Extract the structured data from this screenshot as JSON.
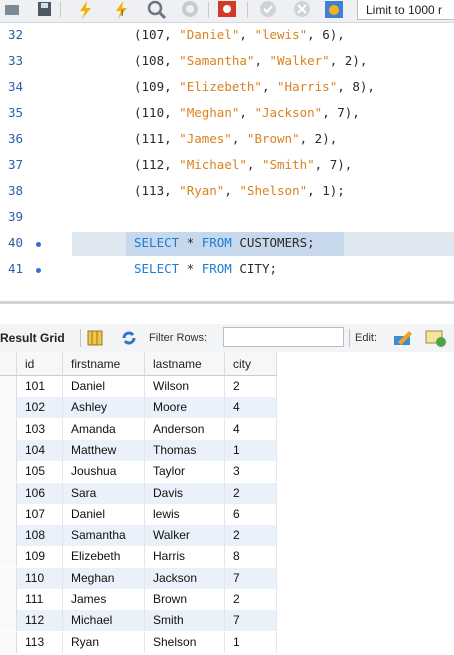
{
  "toolbar": {
    "limit_label": "Limit to 1000 r",
    "icons": [
      "folder-icon",
      "save-icon",
      "execute-icon",
      "execute-current-icon",
      "find-icon",
      "stop-icon",
      "toggle-output-icon",
      "commit-icon",
      "rollback-icon",
      "autocommit-icon"
    ]
  },
  "editor": {
    "lines": [
      {
        "n": "32",
        "parts": [
          {
            "t": "(",
            "c": "id"
          },
          {
            "t": "107",
            "c": "num"
          },
          {
            "t": ", ",
            "c": "id"
          },
          {
            "t": "\"Daniel\"",
            "c": "str"
          },
          {
            "t": ", ",
            "c": "id"
          },
          {
            "t": "\"lewis\"",
            "c": "str"
          },
          {
            "t": ", ",
            "c": "id"
          },
          {
            "t": "6",
            "c": "num"
          },
          {
            "t": "),",
            "c": "id"
          }
        ]
      },
      {
        "n": "33",
        "parts": [
          {
            "t": "(",
            "c": "id"
          },
          {
            "t": "108",
            "c": "num"
          },
          {
            "t": ", ",
            "c": "id"
          },
          {
            "t": "\"Samantha\"",
            "c": "str"
          },
          {
            "t": ", ",
            "c": "id"
          },
          {
            "t": "\"Walker\"",
            "c": "str"
          },
          {
            "t": ", ",
            "c": "id"
          },
          {
            "t": "2",
            "c": "num"
          },
          {
            "t": "),",
            "c": "id"
          }
        ]
      },
      {
        "n": "34",
        "parts": [
          {
            "t": "(",
            "c": "id"
          },
          {
            "t": "109",
            "c": "num"
          },
          {
            "t": ", ",
            "c": "id"
          },
          {
            "t": "\"Elizebeth\"",
            "c": "str"
          },
          {
            "t": ", ",
            "c": "id"
          },
          {
            "t": "\"Harris\"",
            "c": "str"
          },
          {
            "t": ", ",
            "c": "id"
          },
          {
            "t": "8",
            "c": "num"
          },
          {
            "t": "),",
            "c": "id"
          }
        ]
      },
      {
        "n": "35",
        "parts": [
          {
            "t": "(",
            "c": "id"
          },
          {
            "t": "110",
            "c": "num"
          },
          {
            "t": ", ",
            "c": "id"
          },
          {
            "t": "\"Meghan\"",
            "c": "str"
          },
          {
            "t": ", ",
            "c": "id"
          },
          {
            "t": "\"Jackson\"",
            "c": "str"
          },
          {
            "t": ", ",
            "c": "id"
          },
          {
            "t": "7",
            "c": "num"
          },
          {
            "t": "),",
            "c": "id"
          }
        ]
      },
      {
        "n": "36",
        "parts": [
          {
            "t": "(",
            "c": "id"
          },
          {
            "t": "111",
            "c": "num"
          },
          {
            "t": ", ",
            "c": "id"
          },
          {
            "t": "\"James\"",
            "c": "str"
          },
          {
            "t": ", ",
            "c": "id"
          },
          {
            "t": "\"Brown\"",
            "c": "str"
          },
          {
            "t": ", ",
            "c": "id"
          },
          {
            "t": "2",
            "c": "num"
          },
          {
            "t": "),",
            "c": "id"
          }
        ]
      },
      {
        "n": "37",
        "parts": [
          {
            "t": "(",
            "c": "id"
          },
          {
            "t": "112",
            "c": "num"
          },
          {
            "t": ", ",
            "c": "id"
          },
          {
            "t": "\"Michael\"",
            "c": "str"
          },
          {
            "t": ", ",
            "c": "id"
          },
          {
            "t": "\"Smith\"",
            "c": "str"
          },
          {
            "t": ", ",
            "c": "id"
          },
          {
            "t": "7",
            "c": "num"
          },
          {
            "t": "),",
            "c": "id"
          }
        ]
      },
      {
        "n": "38",
        "parts": [
          {
            "t": "(",
            "c": "id"
          },
          {
            "t": "113",
            "c": "num"
          },
          {
            "t": ", ",
            "c": "id"
          },
          {
            "t": "\"Ryan\"",
            "c": "str"
          },
          {
            "t": ", ",
            "c": "id"
          },
          {
            "t": "\"Shelson\"",
            "c": "str"
          },
          {
            "t": ", ",
            "c": "id"
          },
          {
            "t": "1",
            "c": "num"
          },
          {
            "t": ");",
            "c": "id"
          }
        ]
      },
      {
        "n": "39",
        "parts": []
      },
      {
        "n": "40",
        "dot": true,
        "highlight": true,
        "parts": [
          {
            "t": "SELECT",
            "c": "kw"
          },
          {
            "t": " * ",
            "c": "id"
          },
          {
            "t": "FROM",
            "c": "kw"
          },
          {
            "t": " CUSTOMERS;",
            "c": "id"
          }
        ]
      },
      {
        "n": "41",
        "dot": true,
        "parts": [
          {
            "t": "SELECT",
            "c": "kw"
          },
          {
            "t": " * ",
            "c": "id"
          },
          {
            "t": "FROM",
            "c": "kw"
          },
          {
            "t": " CITY;",
            "c": "id"
          }
        ]
      }
    ]
  },
  "result": {
    "title": "Result Grid",
    "filter_label": "Filter Rows:",
    "filter_value": "",
    "edit_label": "Edit:",
    "columns": [
      "id",
      "firstname",
      "lastname",
      "city"
    ],
    "rows": [
      [
        "101",
        "Daniel",
        "Wilson",
        "2"
      ],
      [
        "102",
        "Ashley",
        "Moore",
        "4"
      ],
      [
        "103",
        "Amanda",
        "Anderson",
        "4"
      ],
      [
        "104",
        "Matthew",
        "Thomas",
        "1"
      ],
      [
        "105",
        "Joushua",
        "Taylor",
        "3"
      ],
      [
        "106",
        "Sara",
        "Davis",
        "2"
      ],
      [
        "107",
        "Daniel",
        "lewis",
        "6"
      ],
      [
        "108",
        "Samantha",
        "Walker",
        "2"
      ],
      [
        "109",
        "Elizebeth",
        "Harris",
        "8"
      ],
      [
        "110",
        "Meghan",
        "Jackson",
        "7"
      ],
      [
        "111",
        "James",
        "Brown",
        "2"
      ],
      [
        "112",
        "Michael",
        "Smith",
        "7"
      ],
      [
        "113",
        "Ryan",
        "Shelson",
        "1"
      ]
    ]
  },
  "colors": {
    "keyword": "#1c7cd6",
    "string": "#d9821f",
    "line_number": "#2b5fa8",
    "row_alt": "#eaf1fa"
  }
}
